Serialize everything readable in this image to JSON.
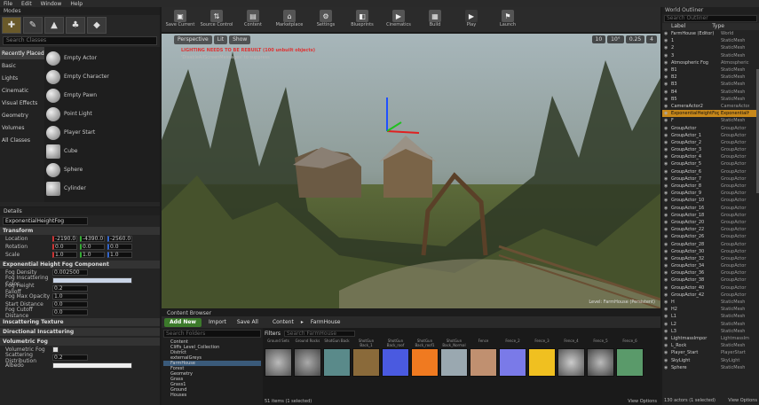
{
  "menu": [
    "File",
    "Edit",
    "Window",
    "Help"
  ],
  "modes": {
    "title": "Modes",
    "search_placeholder": "Search Classes",
    "categories": [
      "Recently Placed",
      "Basic",
      "Lights",
      "Cinematic",
      "Visual Effects",
      "Geometry",
      "Volumes",
      "All Classes"
    ],
    "items": [
      "Empty Actor",
      "Empty Character",
      "Empty Pawn",
      "Point Light",
      "Player Start",
      "Cube",
      "Sphere",
      "Cylinder"
    ]
  },
  "details": {
    "title": "Details",
    "name": "ExponentialHeightFog",
    "transform": "Transform",
    "location": {
      "label": "Location",
      "x": "-2190.0",
      "y": "-4390.0",
      "z": "-2560.0"
    },
    "rotation": {
      "label": "Rotation",
      "x": "0.0",
      "y": "0.0",
      "z": "0.0"
    },
    "scale": {
      "label": "Scale",
      "x": "1.0",
      "y": "1.0",
      "z": "1.0"
    },
    "fog_section": "Exponential Height Fog Component",
    "fog_density": {
      "label": "Fog Density",
      "value": "0.002500"
    },
    "fog_inscatter": {
      "label": "Fog Inscattering Color"
    },
    "fog_falloff": {
      "label": "Fog Height Falloff",
      "value": "0.2"
    },
    "fog_max_opacity": {
      "label": "Fog Max Opacity",
      "value": "1.0"
    },
    "start_distance": {
      "label": "Start Distance",
      "value": "0.0"
    },
    "cutoff": {
      "label": "Fog Cutoff Distance",
      "value": "0.0"
    },
    "inscatter_tex": "Inscattering Texture",
    "dir_inscatter": "Directional Inscattering",
    "vol_fog": "Volumetric Fog",
    "vol_fog_row": {
      "label": "Volumetric Fog"
    },
    "scatter_dist": {
      "label": "Scattering Distribution",
      "value": "0.2"
    },
    "albedo": {
      "label": "Albedo"
    }
  },
  "toolbar": [
    "Save Current",
    "Source Control",
    "Content",
    "Marketplace",
    "Settings",
    "Blueprints",
    "Cinematics",
    "Build",
    "Play",
    "Launch"
  ],
  "viewport": {
    "perspective": "Perspective",
    "lit": "Lit",
    "show": "Show",
    "warning": "LIGHTING NEEDS TO BE REBUILT (100 unbuilt objects)",
    "warning2": "'DisableAllScreenMessages' to suppress",
    "right_controls": [
      "10",
      "10°",
      "0.25",
      "4"
    ],
    "level": "Level: FarmHouse (Persistent)"
  },
  "content": {
    "tab": "Content Browser",
    "add_new": "Add New",
    "import": "Import",
    "save_all": "Save All",
    "crumbs": [
      "Content",
      "FarmHouse"
    ],
    "filters": "Filters",
    "search": "Search FarmHouse",
    "tree_search": "Search Folders",
    "tree": [
      "Content",
      "Cliffs_Level_Collection",
      "District",
      "externalGreys",
      "FarmHouse",
      "Forest",
      "Geometry",
      "Grass",
      "Grass1",
      "Ground",
      "Houses"
    ],
    "asset_labels": [
      "Ground Sets",
      "Ground Rocks",
      "ShotGun Back",
      "ShotGun Back_1",
      "ShotGun Back_roof",
      "ShotGun Back_roof1",
      "ShotGun Back_Normal",
      "Fence",
      "Fence_2",
      "Fence_3",
      "Fence_4",
      "Fence_5",
      "Fence_6"
    ],
    "item_count": "51 items (1 selected)",
    "view_options": "View Options"
  },
  "outliner": {
    "title": "World Outliner",
    "search": "Search Outliner",
    "col_label": "Label",
    "col_type": "Type",
    "rows": [
      [
        "FarmHouse (Editor)",
        "World"
      ],
      [
        "1",
        "StaticMesh"
      ],
      [
        "2",
        "StaticMesh"
      ],
      [
        "3",
        "StaticMesh"
      ],
      [
        "Atmospheric Fog",
        "AtmosphericF"
      ],
      [
        "B1",
        "StaticMesh"
      ],
      [
        "B2",
        "StaticMesh"
      ],
      [
        "B3",
        "StaticMesh"
      ],
      [
        "B4",
        "StaticMesh"
      ],
      [
        "B5",
        "StaticMesh"
      ],
      [
        "CameraActor2",
        "CameraActor"
      ],
      [
        "ExponentialHeightFog",
        "ExponentialH"
      ],
      [
        "F",
        "StaticMesh"
      ],
      [
        "GroupActor",
        "GroupActor"
      ],
      [
        "GroupActor_1",
        "GroupActor"
      ],
      [
        "GroupActor_2",
        "GroupActor"
      ],
      [
        "GroupActor_3",
        "GroupActor"
      ],
      [
        "GroupActor_4",
        "GroupActor"
      ],
      [
        "GroupActor_5",
        "GroupActor"
      ],
      [
        "GroupActor_6",
        "GroupActor"
      ],
      [
        "GroupActor_7",
        "GroupActor"
      ],
      [
        "GroupActor_8",
        "GroupActor"
      ],
      [
        "GroupActor_9",
        "GroupActor"
      ],
      [
        "GroupActor_10",
        "GroupActor"
      ],
      [
        "GroupActor_16",
        "GroupActor"
      ],
      [
        "GroupActor_18",
        "GroupActor"
      ],
      [
        "GroupActor_20",
        "GroupActor"
      ],
      [
        "GroupActor_22",
        "GroupActor"
      ],
      [
        "GroupActor_26",
        "GroupActor"
      ],
      [
        "GroupActor_28",
        "GroupActor"
      ],
      [
        "GroupActor_30",
        "GroupActor"
      ],
      [
        "GroupActor_32",
        "GroupActor"
      ],
      [
        "GroupActor_34",
        "GroupActor"
      ],
      [
        "GroupActor_36",
        "GroupActor"
      ],
      [
        "GroupActor_38",
        "GroupActor"
      ],
      [
        "GroupActor_40",
        "GroupActor"
      ],
      [
        "GroupActor_42",
        "GroupActor"
      ],
      [
        "H",
        "StaticMesh"
      ],
      [
        "H2",
        "StaticMesh"
      ],
      [
        "L1",
        "StaticMesh"
      ],
      [
        "L2",
        "StaticMesh"
      ],
      [
        "L3",
        "StaticMesh"
      ],
      [
        "LightmassImpor",
        "LightmassIm"
      ],
      [
        "L_Rock",
        "StaticMesh"
      ],
      [
        "Player_Start",
        "PlayerStart"
      ],
      [
        "SkyLight",
        "SkyLight"
      ],
      [
        "Sphere",
        "StaticMesh"
      ]
    ],
    "selected_index": 11,
    "count": "130 actors (1 selected)",
    "view_options": "View Options"
  }
}
